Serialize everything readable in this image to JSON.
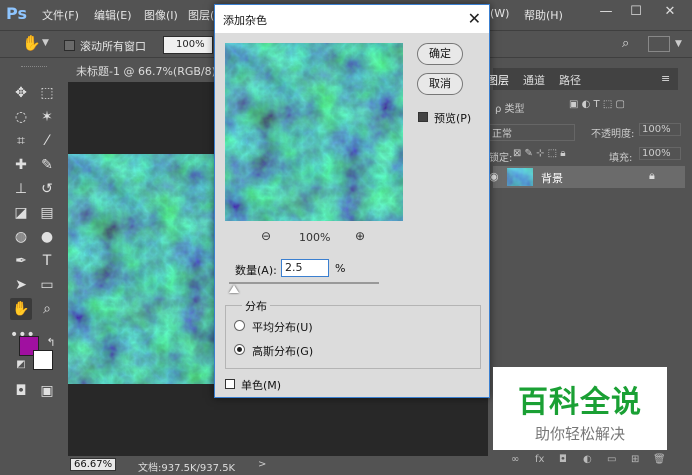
{
  "app": {
    "logo": "Ps",
    "menus": [
      "文件(F)",
      "编辑(E)",
      "图像(I)",
      "图层(",
      "(W)",
      "帮助(H)"
    ]
  },
  "options_bar": {
    "scroll_all_label": "滚动所有窗口",
    "zoom_value": "100%"
  },
  "document": {
    "tab_title": "未标题-1 @ 66.7%(RGB/8) *",
    "zoom_status": "66.67%",
    "doc_info": "文档:937.5K/937.5K"
  },
  "layers_panel": {
    "tabs": [
      "图层",
      "通道",
      "路径"
    ],
    "filter_label": "类型",
    "blend_mode": "正常",
    "opacity_label": "不透明度:",
    "opacity_value": "100%",
    "lock_label": "锁定:",
    "fill_label": "填充:",
    "fill_value": "100%",
    "layers": [
      {
        "name": "背景"
      }
    ]
  },
  "dialog": {
    "title": "添加杂色",
    "ok_label": "确定",
    "cancel_label": "取消",
    "preview_label": "预览(P)",
    "preview_checked": true,
    "zoom_level": "100%",
    "amount_label": "数量(A):",
    "amount_value": "2.5",
    "amount_unit": "%",
    "distribution_group": "分布",
    "uniform_label": "平均分布(U)",
    "gaussian_label": "高斯分布(G)",
    "selected_distribution": "gaussian",
    "mono_label": "单色(M)",
    "mono_checked": false
  },
  "watermark": {
    "title": "百科全说",
    "subtitle": "助你轻松解决"
  },
  "colors": {
    "foreground": "#a010a0",
    "background": "#ffffff",
    "accent": "#3a7fd0"
  }
}
